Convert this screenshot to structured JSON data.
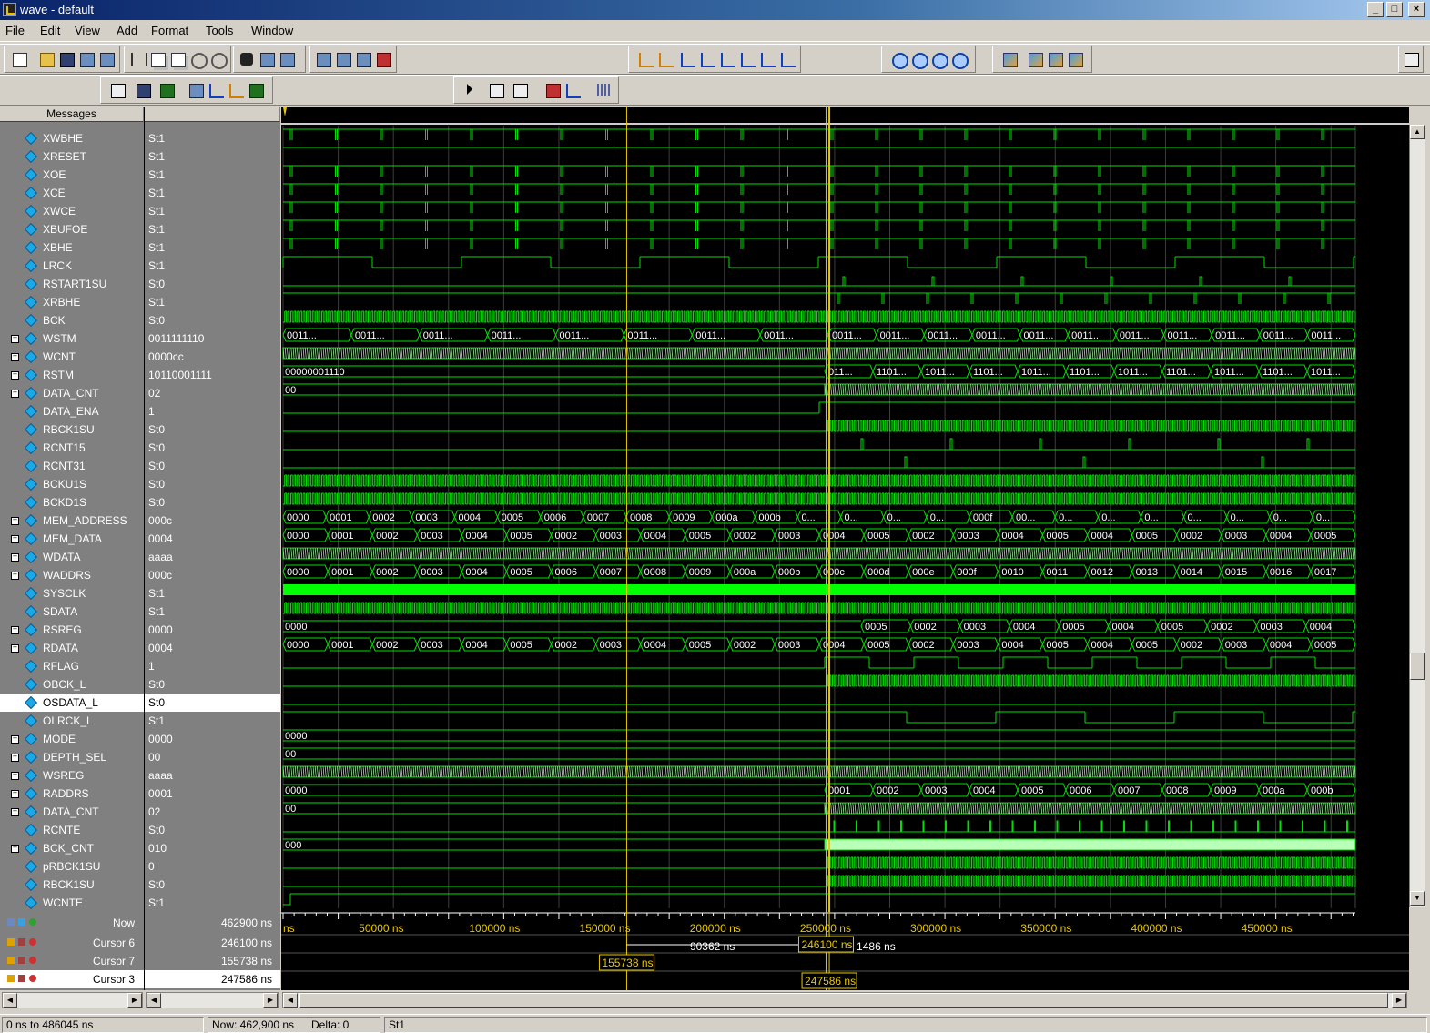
{
  "window": {
    "title": "wave - default",
    "buttons": [
      "_",
      "□",
      "×"
    ]
  },
  "menu": [
    {
      "label": "File",
      "key": "F"
    },
    {
      "label": "Edit",
      "key": "E"
    },
    {
      "label": "View",
      "key": "V"
    },
    {
      "label": "Add",
      "key": "A"
    },
    {
      "label": "Format",
      "key": "o"
    },
    {
      "label": "Tools",
      "key": "T"
    },
    {
      "label": "Window",
      "key": "W"
    }
  ],
  "panes": {
    "messages_header": "Messages"
  },
  "signals": [
    {
      "name": "XWBHE",
      "value": "St1",
      "bus": false
    },
    {
      "name": "XRESET",
      "value": "St1",
      "bus": false
    },
    {
      "name": "XOE",
      "value": "St1",
      "bus": false
    },
    {
      "name": "XCE",
      "value": "St1",
      "bus": false
    },
    {
      "name": "XWCE",
      "value": "St1",
      "bus": false
    },
    {
      "name": "XBUFOE",
      "value": "St1",
      "bus": false
    },
    {
      "name": "XBHE",
      "value": "St1",
      "bus": false
    },
    {
      "name": "LRCK",
      "value": "St1",
      "bus": false
    },
    {
      "name": "RSTART1SU",
      "value": "St0",
      "bus": false
    },
    {
      "name": "XRBHE",
      "value": "St1",
      "bus": false
    },
    {
      "name": "BCK",
      "value": "St0",
      "bus": false
    },
    {
      "name": "WSTM",
      "value": "0011111110",
      "bus": true
    },
    {
      "name": "WCNT",
      "value": "0000cc",
      "bus": true
    },
    {
      "name": "RSTM",
      "value": "10110001111",
      "bus": true
    },
    {
      "name": "DATA_CNT",
      "value": "02",
      "bus": true
    },
    {
      "name": "DATA_ENA",
      "value": "1",
      "bus": false
    },
    {
      "name": "RBCK1SU",
      "value": "St0",
      "bus": false
    },
    {
      "name": "RCNT15",
      "value": "St0",
      "bus": false
    },
    {
      "name": "RCNT31",
      "value": "St0",
      "bus": false
    },
    {
      "name": "BCKU1S",
      "value": "St0",
      "bus": false
    },
    {
      "name": "BCKD1S",
      "value": "St0",
      "bus": false
    },
    {
      "name": "MEM_ADDRESS",
      "value": "000c",
      "bus": true
    },
    {
      "name": "MEM_DATA",
      "value": "0004",
      "bus": true
    },
    {
      "name": "WDATA",
      "value": "aaaa",
      "bus": true
    },
    {
      "name": "WADDRS",
      "value": "000c",
      "bus": true
    },
    {
      "name": "SYSCLK",
      "value": "St1",
      "bus": false
    },
    {
      "name": "SDATA",
      "value": "St1",
      "bus": false
    },
    {
      "name": "RSREG",
      "value": "0000",
      "bus": true
    },
    {
      "name": "RDATA",
      "value": "0004",
      "bus": true
    },
    {
      "name": "RFLAG",
      "value": "1",
      "bus": false
    },
    {
      "name": "OBCK_L",
      "value": "St0",
      "bus": false
    },
    {
      "name": "OSDATA_L",
      "value": "St0",
      "bus": false,
      "selected": true
    },
    {
      "name": "OLRCK_L",
      "value": "St1",
      "bus": false
    },
    {
      "name": "MODE",
      "value": "0000",
      "bus": true
    },
    {
      "name": "DEPTH_SEL",
      "value": "00",
      "bus": true
    },
    {
      "name": "WSREG",
      "value": "aaaa",
      "bus": true
    },
    {
      "name": "RADDRS",
      "value": "0001",
      "bus": true
    },
    {
      "name": "DATA_CNT",
      "value": "02",
      "bus": true
    },
    {
      "name": "RCNTE",
      "value": "St0",
      "bus": false
    },
    {
      "name": "BCK_CNT",
      "value": "010",
      "bus": true
    },
    {
      "name": "pRBCK1SU",
      "value": "0",
      "bus": false
    },
    {
      "name": "RBCK1SU",
      "value": "St0",
      "bus": false
    },
    {
      "name": "WCNTE",
      "value": "St1",
      "bus": false
    }
  ],
  "bus_labels": {
    "WSTM_pre": [
      "0011...",
      "0011...",
      "0011...",
      "0011...",
      "0011...",
      "0011...",
      "0011...",
      "0011..."
    ],
    "WSTM_post": [
      "0011...",
      "0011...",
      "0011...",
      "0011...",
      "0011...",
      "0011...",
      "0011...",
      "0011...",
      "0011...",
      "0011...",
      "0011...",
      "0011...",
      "0011...",
      "0011...",
      "0011...",
      "0011..."
    ],
    "RSTM_first": "00000001110",
    "RSTM_post": [
      "011...",
      "1101...",
      "1011...",
      "1101...",
      "1011...",
      "1101...",
      "1011...",
      "1101...",
      "1011...",
      "1101...",
      "1011..."
    ],
    "DATA_CNT_first": "00",
    "MEM_ADDRESS": [
      "0000",
      "0001",
      "0002",
      "0003",
      "0004",
      "0005",
      "0006",
      "0007",
      "0008",
      "0009",
      "000a",
      "000b",
      "0...",
      "0...",
      "0...",
      "0...",
      "000f",
      "00...",
      "0...",
      "0...",
      "0...",
      "0...",
      "0...",
      "0...",
      "0..."
    ],
    "MEM_DATA": [
      "0000",
      "0001",
      "0002",
      "0003",
      "0004",
      "0005",
      "0002",
      "0003",
      "0004",
      "0005",
      "0002",
      "0003",
      "0004",
      "0005",
      "0002",
      "0003",
      "0004",
      "0005",
      "0004",
      "0005",
      "0002",
      "0003",
      "0004",
      "0005"
    ],
    "WADDRS": [
      "0000",
      "0001",
      "0002",
      "0003",
      "0004",
      "0005",
      "0006",
      "0007",
      "0008",
      "0009",
      "000a",
      "000b",
      "000c",
      "000d",
      "000e",
      "000f",
      "0010",
      "0011",
      "0012",
      "0013",
      "0014",
      "0015",
      "0016",
      "0017"
    ],
    "RSREG_first": "0000",
    "RSREG_post": [
      "0005",
      "0002",
      "0003",
      "0004",
      "0005",
      "0004",
      "0005",
      "0002",
      "0003",
      "0004"
    ],
    "RDATA": [
      "0000",
      "0001",
      "0002",
      "0003",
      "0004",
      "0005",
      "0002",
      "0003",
      "0004",
      "0005",
      "0002",
      "0003",
      "0004",
      "0005",
      "0002",
      "0003",
      "0004",
      "0005",
      "0004",
      "0005",
      "0002",
      "0003",
      "0004",
      "0005"
    ],
    "MODE_first": "0000",
    "DEPTH_SEL_first": "00",
    "RADDRS_first": "0000",
    "RADDRS_post": [
      "0001",
      "0002",
      "0003",
      "0004",
      "0005",
      "0006",
      "0007",
      "0008",
      "0009",
      "000a",
      "000b"
    ],
    "DATA_CNT2_first": "00",
    "BCK_CNT_first": "000"
  },
  "timeline": {
    "ticks": [
      "ns",
      "50000 ns",
      "100000 ns",
      "150000 ns",
      "200000 ns",
      "250000 ns",
      "300000 ns",
      "350000 ns",
      "400000 ns",
      "450000 ns"
    ],
    "tick_values_ns": [
      0,
      50000,
      100000,
      150000,
      200000,
      250000,
      300000,
      350000,
      400000,
      450000
    ],
    "view_start_ns": 0,
    "view_end_ns": 486045,
    "delta_a": "90362 ns",
    "delta_b": "1486 ns"
  },
  "cursors": [
    {
      "label": "Now",
      "value": "462900 ns",
      "tag": "",
      "time_ns": 462900
    },
    {
      "label": "Cursor 6",
      "value": "246100 ns",
      "tag": "246100 ns",
      "time_ns": 246100
    },
    {
      "label": "Cursor 7",
      "value": "155738 ns",
      "tag": "155738 ns",
      "time_ns": 155738
    },
    {
      "label": "Cursor 3",
      "value": "247586 ns",
      "tag": "247586 ns",
      "time_ns": 247586,
      "selected": true
    }
  ],
  "status": {
    "range": "0 ns to 486045 ns",
    "now": "Now: 462,900 ns",
    "delta": "Delta: 0",
    "value": "St1"
  },
  "colors": {
    "wave": "#00e000",
    "bus_fill": "#b8ffb8",
    "cursor": "#e8c800",
    "grid": "#3c3c3c",
    "signal_icon": "#19a8e8"
  }
}
